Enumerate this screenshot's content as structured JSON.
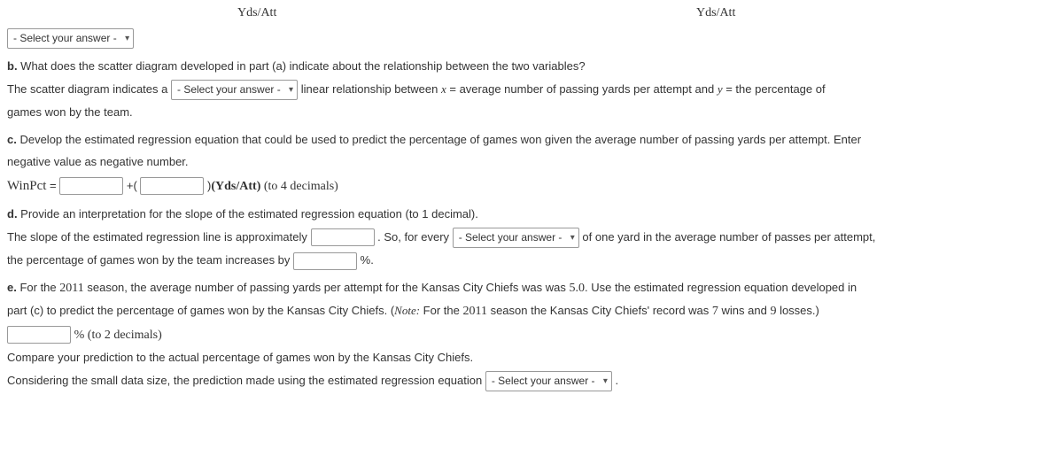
{
  "axis": {
    "left": "Yds/Att",
    "right": "Yds/Att"
  },
  "select": {
    "placeholder": "- Select your answer -"
  },
  "b": {
    "prompt_prefix": "b.",
    "prompt": " What does the scatter diagram developed in part (a) indicate about the relationship between the two variables?",
    "line1_pre": "The scatter diagram indicates a ",
    "line1_mid": " linear relationship between ",
    "xvar": "x",
    "eq1": " = average number of passing yards per attempt and ",
    "yvar": "y",
    "eq2": " = the percentage of",
    "line2": "games won by the team."
  },
  "c": {
    "prompt_prefix": "c.",
    "prompt": " Develop the estimated regression equation that could be used to predict the percentage of games won given the average number of passing yards per attempt. Enter",
    "prompt2": "negative value as negative number.",
    "lhs": "WinPct",
    "eq": " = ",
    "plus": " +(",
    "close": ")",
    "yds": "(Yds/Att)",
    "precision": " (to 4 decimals)"
  },
  "d": {
    "prompt_prefix": "d.",
    "prompt": " Provide an interpretation for the slope of the estimated regression equation (to 1 decimal).",
    "line1_pre": "The slope of the estimated regression line is approximately ",
    "line1_post": ". So, for every ",
    "line1_end": " of one yard in the average number of passes per attempt,",
    "line2_pre": "the percentage of games won by the team increases by ",
    "line2_post": " %."
  },
  "e": {
    "prompt_prefix": "e.",
    "prompt_pre": " For the ",
    "year": "2011",
    "prompt_mid": " season, the average number of passing yards per attempt for the Kansas City Chiefs was was ",
    "value": "5.0",
    "prompt_post": ". Use the estimated regression equation developed in",
    "line2_pre": "part (c) to predict the percentage of games won by the Kansas City Chiefs. (",
    "note_label": "Note:",
    "note_pre": " For the ",
    "note_mid": " season the Kansas City Chiefs' record was ",
    "wins": "7",
    "wins_word": " wins and ",
    "losses": "9",
    "note_post": " losses.)",
    "pct_unit": " % (to 2 decimals)",
    "compare": "Compare your prediction to the actual percentage of games won by the Kansas City Chiefs.",
    "closing_pre": "Considering the small data size, the prediction made using the estimated regression equation ",
    "closing_post": " ."
  }
}
